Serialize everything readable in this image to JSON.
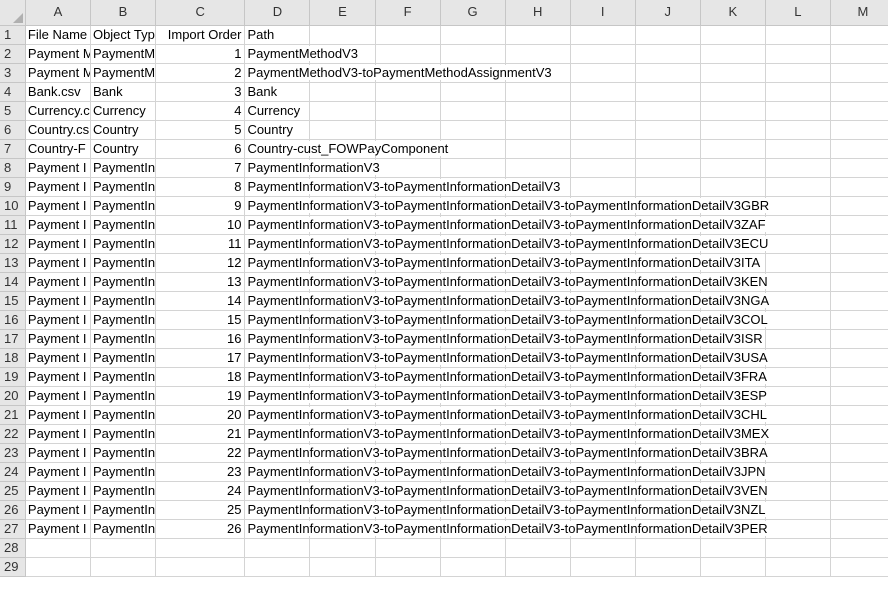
{
  "columns": [
    "A",
    "B",
    "C",
    "D",
    "E",
    "F",
    "G",
    "H",
    "I",
    "J",
    "K",
    "L",
    "M"
  ],
  "rows": [
    {
      "n": "1",
      "a": "File Name",
      "b": "Object Typ",
      "c": "Import Order",
      "d": "Path"
    },
    {
      "n": "2",
      "a": "Payment M",
      "b": "PaymentMe",
      "c": "1",
      "d": "PaymentMethodV3"
    },
    {
      "n": "3",
      "a": "Payment M",
      "b": "PaymentMe",
      "c": "2",
      "d": "PaymentMethodV3-toPaymentMethodAssignmentV3"
    },
    {
      "n": "4",
      "a": "Bank.csv",
      "b": "Bank",
      "c": "3",
      "d": "Bank"
    },
    {
      "n": "5",
      "a": "Currency.c",
      "b": "Currency",
      "c": "4",
      "d": "Currency"
    },
    {
      "n": "6",
      "a": "Country.cs",
      "b": "Country",
      "c": "5",
      "d": "Country"
    },
    {
      "n": "7",
      "a": "Country-F",
      "b": "Country",
      "c": "6",
      "d": "Country-cust_FOWPayComponent"
    },
    {
      "n": "8",
      "a": "Payment I",
      "b": "PaymentIn",
      "c": "7",
      "d": "PaymentInformationV3"
    },
    {
      "n": "9",
      "a": "Payment I",
      "b": "PaymentIn",
      "c": "8",
      "d": "PaymentInformationV3-toPaymentInformationDetailV3"
    },
    {
      "n": "10",
      "a": "Payment I",
      "b": "PaymentIn",
      "c": "9",
      "d": "PaymentInformationV3-toPaymentInformationDetailV3-toPaymentInformationDetailV3GBR"
    },
    {
      "n": "11",
      "a": "Payment I",
      "b": "PaymentIn",
      "c": "10",
      "d": "PaymentInformationV3-toPaymentInformationDetailV3-toPaymentInformationDetailV3ZAF"
    },
    {
      "n": "12",
      "a": "Payment I",
      "b": "PaymentIn",
      "c": "11",
      "d": "PaymentInformationV3-toPaymentInformationDetailV3-toPaymentInformationDetailV3ECU"
    },
    {
      "n": "13",
      "a": "Payment I",
      "b": "PaymentIn",
      "c": "12",
      "d": "PaymentInformationV3-toPaymentInformationDetailV3-toPaymentInformationDetailV3ITA"
    },
    {
      "n": "14",
      "a": "Payment I",
      "b": "PaymentIn",
      "c": "13",
      "d": "PaymentInformationV3-toPaymentInformationDetailV3-toPaymentInformationDetailV3KEN"
    },
    {
      "n": "15",
      "a": "Payment I",
      "b": "PaymentIn",
      "c": "14",
      "d": "PaymentInformationV3-toPaymentInformationDetailV3-toPaymentInformationDetailV3NGA"
    },
    {
      "n": "16",
      "a": "Payment I",
      "b": "PaymentIn",
      "c": "15",
      "d": "PaymentInformationV3-toPaymentInformationDetailV3-toPaymentInformationDetailV3COL"
    },
    {
      "n": "17",
      "a": "Payment I",
      "b": "PaymentIn",
      "c": "16",
      "d": "PaymentInformationV3-toPaymentInformationDetailV3-toPaymentInformationDetailV3ISR"
    },
    {
      "n": "18",
      "a": "Payment I",
      "b": "PaymentIn",
      "c": "17",
      "d": "PaymentInformationV3-toPaymentInformationDetailV3-toPaymentInformationDetailV3USA"
    },
    {
      "n": "19",
      "a": "Payment I",
      "b": "PaymentIn",
      "c": "18",
      "d": "PaymentInformationV3-toPaymentInformationDetailV3-toPaymentInformationDetailV3FRA"
    },
    {
      "n": "20",
      "a": "Payment I",
      "b": "PaymentIn",
      "c": "19",
      "d": "PaymentInformationV3-toPaymentInformationDetailV3-toPaymentInformationDetailV3ESP"
    },
    {
      "n": "21",
      "a": "Payment I",
      "b": "PaymentIn",
      "c": "20",
      "d": "PaymentInformationV3-toPaymentInformationDetailV3-toPaymentInformationDetailV3CHL"
    },
    {
      "n": "22",
      "a": "Payment I",
      "b": "PaymentIn",
      "c": "21",
      "d": "PaymentInformationV3-toPaymentInformationDetailV3-toPaymentInformationDetailV3MEX"
    },
    {
      "n": "23",
      "a": "Payment I",
      "b": "PaymentIn",
      "c": "22",
      "d": "PaymentInformationV3-toPaymentInformationDetailV3-toPaymentInformationDetailV3BRA"
    },
    {
      "n": "24",
      "a": "Payment I",
      "b": "PaymentIn",
      "c": "23",
      "d": "PaymentInformationV3-toPaymentInformationDetailV3-toPaymentInformationDetailV3JPN"
    },
    {
      "n": "25",
      "a": "Payment I",
      "b": "PaymentIn",
      "c": "24",
      "d": "PaymentInformationV3-toPaymentInformationDetailV3-toPaymentInformationDetailV3VEN"
    },
    {
      "n": "26",
      "a": "Payment I",
      "b": "PaymentIn",
      "c": "25",
      "d": "PaymentInformationV3-toPaymentInformationDetailV3-toPaymentInformationDetailV3NZL"
    },
    {
      "n": "27",
      "a": "Payment I",
      "b": "PaymentIn",
      "c": "26",
      "d": "PaymentInformationV3-toPaymentInformationDetailV3-toPaymentInformationDetailV3PER"
    },
    {
      "n": "28",
      "a": "",
      "b": "",
      "c": "",
      "d": ""
    },
    {
      "n": "29",
      "a": "",
      "b": "",
      "c": "",
      "d": ""
    }
  ]
}
